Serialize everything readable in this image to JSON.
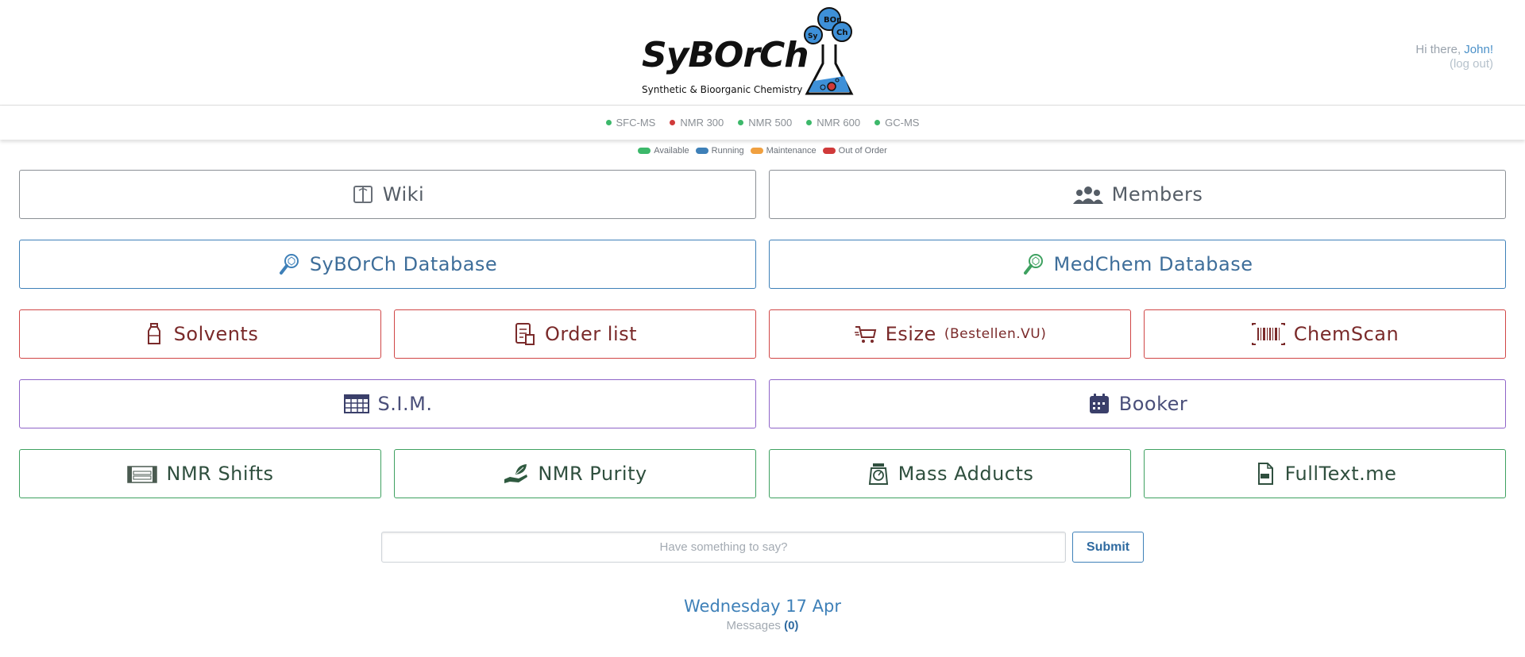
{
  "header": {
    "logo_text": "SyBOrCh",
    "logo_subtitle": "Synthetic & Bioorganic Chemistry",
    "greeting": "Hi there,",
    "user_name": "John!",
    "logout": "(log out)"
  },
  "instruments": [
    {
      "name": "SFC-MS",
      "color": "#3cb86a"
    },
    {
      "name": "NMR 300",
      "color": "#d03a3a"
    },
    {
      "name": "NMR 500",
      "color": "#3cb86a"
    },
    {
      "name": "NMR 600",
      "color": "#3cb86a"
    },
    {
      "name": "GC-MS",
      "color": "#3cb86a"
    }
  ],
  "legend": [
    {
      "label": "Available",
      "color": "#3cb86a"
    },
    {
      "label": "Running",
      "color": "#3e80b8"
    },
    {
      "label": "Maintenance",
      "color": "#f0a040"
    },
    {
      "label": "Out of Order",
      "color": "#d03a3a"
    }
  ],
  "tiles": {
    "wiki": {
      "label": "Wiki",
      "icon": "book-icon"
    },
    "members": {
      "label": "Members",
      "icon": "people-icon"
    },
    "syborch_db": {
      "label": "SyBOrCh Database",
      "icon": "molecule-search-icon"
    },
    "medchem_db": {
      "label": "MedChem Database",
      "icon": "molecule-search-icon"
    },
    "solvents": {
      "label": "Solvents",
      "icon": "bottle-icon"
    },
    "order_list": {
      "label": "Order list",
      "icon": "clipboard-icon"
    },
    "esize": {
      "label": "Esize",
      "sub": "(Bestellen.VU)",
      "icon": "cart-icon"
    },
    "chemscan": {
      "label": "ChemScan",
      "icon": "barcode-icon"
    },
    "sim": {
      "label": "S.I.M.",
      "icon": "table-icon"
    },
    "booker": {
      "label": "Booker",
      "icon": "calendar-icon"
    },
    "nmr_shifts": {
      "label": "NMR Shifts",
      "icon": "periodic-table-icon"
    },
    "nmr_purity": {
      "label": "NMR Purity",
      "icon": "hand-leaf-icon"
    },
    "mass_adducts": {
      "label": "Mass Adducts",
      "icon": "scale-icon"
    },
    "fulltext": {
      "label": "FullText.me",
      "icon": "pdf-file-icon"
    }
  },
  "feedback": {
    "placeholder": "Have something to say?",
    "submit": "Submit"
  },
  "footer": {
    "date": "Wednesday 17 Apr",
    "messages_label": "Messages",
    "messages_count": "(0)"
  }
}
